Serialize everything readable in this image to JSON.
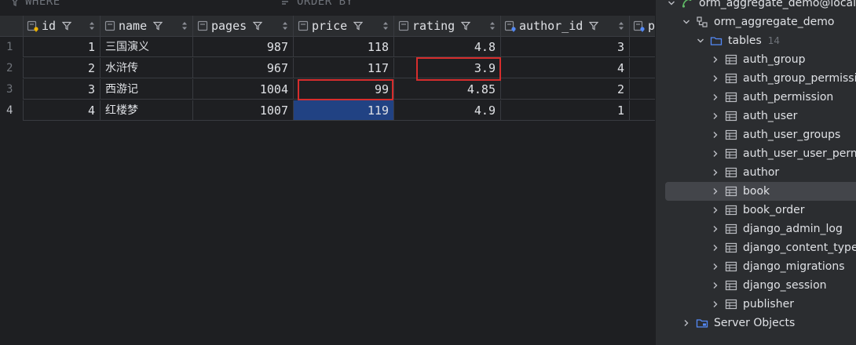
{
  "filter_bar": {
    "where_label": "WHERE",
    "order_by_label": "ORDER BY"
  },
  "grid": {
    "columns": [
      {
        "label": "id"
      },
      {
        "label": "name"
      },
      {
        "label": "pages"
      },
      {
        "label": "price"
      },
      {
        "label": "rating"
      },
      {
        "label": "author_id"
      },
      {
        "label": "p"
      }
    ],
    "rows": [
      {
        "row_num": "1",
        "id": "1",
        "name": "三国演义",
        "pages": "987",
        "price": "118",
        "rating": "4.8",
        "author_id": "3"
      },
      {
        "row_num": "2",
        "id": "2",
        "name": "水浒传",
        "pages": "967",
        "price": "117",
        "rating": "3.9",
        "author_id": "4"
      },
      {
        "row_num": "3",
        "id": "3",
        "name": "西游记",
        "pages": "1004",
        "price": "99",
        "rating": "4.85",
        "author_id": "2"
      },
      {
        "row_num": "4",
        "id": "4",
        "name": "红楼梦",
        "pages": "1007",
        "price": "119",
        "rating": "4.9",
        "author_id": "1"
      }
    ]
  },
  "tree": {
    "connection": "orm_aggregate_demo@localhost",
    "database": "orm_aggregate_demo",
    "tables_label": "tables",
    "tables_count": "14",
    "tables": [
      "auth_group",
      "auth_group_permissions",
      "auth_permission",
      "auth_user",
      "auth_user_groups",
      "auth_user_user_permissions",
      "author",
      "book",
      "book_order",
      "django_admin_log",
      "django_content_type",
      "django_migrations",
      "django_session",
      "publisher"
    ],
    "selected_table": "book",
    "server_objects": "Server Objects"
  },
  "colors": {
    "background": "#1e1f22",
    "panel": "#2b2d30",
    "selection": "#214283",
    "highlight_box": "#d62d2d",
    "folder_icon": "#548af7"
  }
}
